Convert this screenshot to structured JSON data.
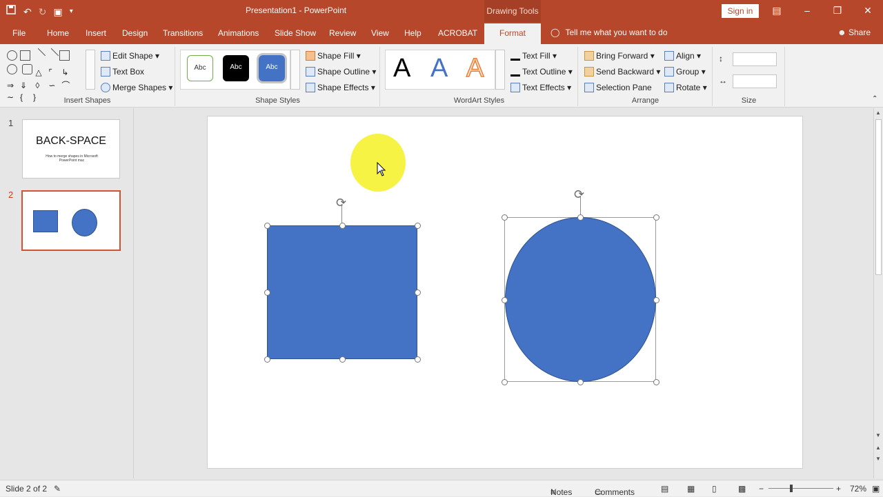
{
  "titlebar": {
    "doc_title": "Presentation1  -  PowerPoint",
    "contextual_title": "Drawing Tools",
    "sign_in": "Sign in",
    "qat_icons": [
      "save-icon",
      "undo-icon",
      "redo-icon",
      "present-icon",
      "customize-icon"
    ],
    "window_controls": [
      "ribbon-options-icon",
      "minimize-icon",
      "restore-icon",
      "close-icon"
    ]
  },
  "tabs": [
    "File",
    "Home",
    "Insert",
    "Design",
    "Transitions",
    "Animations",
    "Slide Show",
    "Review",
    "View",
    "Help",
    "ACROBAT",
    "Format"
  ],
  "active_tab": "Format",
  "tell_me": "Tell me what you want to do",
  "share": "Share",
  "ribbon": {
    "insert_shapes": {
      "label": "Insert Shapes",
      "edit_shape": "Edit Shape",
      "text_box": "Text Box",
      "merge_shapes": "Merge Shapes"
    },
    "shape_styles": {
      "label": "Shape Styles",
      "presets": [
        "Abc",
        "Abc",
        "Abc"
      ],
      "shape_fill": "Shape Fill",
      "shape_outline": "Shape Outline",
      "shape_effects": "Shape Effects"
    },
    "wordart_styles": {
      "label": "WordArt Styles",
      "letters": [
        "A",
        "A",
        "A"
      ],
      "text_fill": "Text Fill",
      "text_outline": "Text Outline",
      "text_effects": "Text Effects"
    },
    "arrange": {
      "label": "Arrange",
      "bring_forward": "Bring Forward",
      "send_backward": "Send Backward",
      "selection_pane": "Selection Pane",
      "align": "Align",
      "group": "Group",
      "rotate": "Rotate"
    },
    "size": {
      "label": "Size"
    }
  },
  "slides_panel": {
    "slides": [
      {
        "number": "1",
        "title": "BACK-SPACE",
        "subtitle": "How to merge shapes in Microsoft PowerPoint mac"
      },
      {
        "number": "2"
      }
    ]
  },
  "status": {
    "slide_indicator": "Slide 2 of 2",
    "notes": "Notes",
    "comments": "Comments",
    "zoom_minus": "−",
    "zoom_plus": "+",
    "zoom_level": "72%"
  },
  "colors": {
    "accent": "#b7472a",
    "shape_fill": "#4472c4",
    "cursor_highlight": "#f5f23a"
  }
}
